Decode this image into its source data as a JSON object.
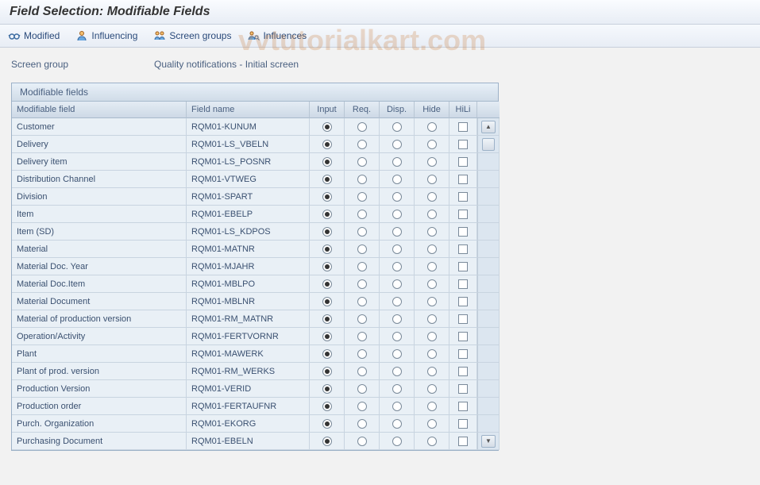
{
  "page": {
    "title": "Field Selection: Modifiable Fields"
  },
  "toolbar": {
    "modified": "Modified",
    "influencing": "Influencing",
    "screen_groups": "Screen groups",
    "influences": "Influences"
  },
  "screen_group": {
    "label": "Screen group",
    "value": "Quality notifications - Initial screen"
  },
  "table": {
    "title": "Modifiable fields",
    "columns": {
      "field": "Modifiable field",
      "name": "Field name",
      "input": "Input",
      "req": "Req.",
      "disp": "Disp.",
      "hide": "Hide",
      "hili": "HiLi"
    },
    "rows": [
      {
        "field": "Customer",
        "name": "RQM01-KUNUM",
        "sel": "input"
      },
      {
        "field": "Delivery",
        "name": "RQM01-LS_VBELN",
        "sel": "input"
      },
      {
        "field": "Delivery item",
        "name": "RQM01-LS_POSNR",
        "sel": "input"
      },
      {
        "field": "Distribution Channel",
        "name": "RQM01-VTWEG",
        "sel": "input"
      },
      {
        "field": "Division",
        "name": "RQM01-SPART",
        "sel": "input"
      },
      {
        "field": "Item",
        "name": "RQM01-EBELP",
        "sel": "input"
      },
      {
        "field": "Item (SD)",
        "name": "RQM01-LS_KDPOS",
        "sel": "input"
      },
      {
        "field": "Material",
        "name": "RQM01-MATNR",
        "sel": "input"
      },
      {
        "field": "Material Doc. Year",
        "name": "RQM01-MJAHR",
        "sel": "input"
      },
      {
        "field": "Material Doc.Item",
        "name": "RQM01-MBLPO",
        "sel": "input"
      },
      {
        "field": "Material Document",
        "name": "RQM01-MBLNR",
        "sel": "input"
      },
      {
        "field": "Material of production version",
        "name": "RQM01-RM_MATNR",
        "sel": "input"
      },
      {
        "field": "Operation/Activity",
        "name": "RQM01-FERTVORNR",
        "sel": "input"
      },
      {
        "field": "Plant",
        "name": "RQM01-MAWERK",
        "sel": "input"
      },
      {
        "field": "Plant of prod. version",
        "name": "RQM01-RM_WERKS",
        "sel": "input"
      },
      {
        "field": "Production Version",
        "name": "RQM01-VERID",
        "sel": "input"
      },
      {
        "field": "Production order",
        "name": "RQM01-FERTAUFNR",
        "sel": "input"
      },
      {
        "field": "Purch. Organization",
        "name": "RQM01-EKORG",
        "sel": "input"
      },
      {
        "field": "Purchasing Document",
        "name": "RQM01-EBELN",
        "sel": "input"
      }
    ]
  },
  "watermark": "vvtutorialkart.com"
}
